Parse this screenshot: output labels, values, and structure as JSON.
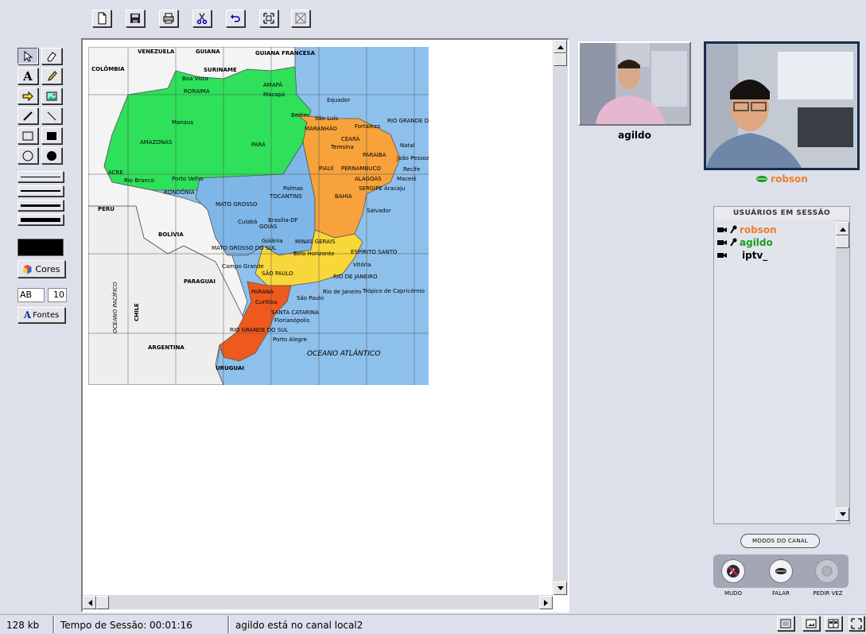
{
  "toolbar": {
    "icons": [
      "new-document-icon",
      "save-icon",
      "print-icon",
      "cut-icon",
      "undo-icon",
      "fit-screen-icon",
      "fullscreen-icon"
    ]
  },
  "tools": {
    "color_label": "Cores",
    "font_sample": "AB",
    "font_size": "10",
    "fonts_label": "Fontes"
  },
  "map": {
    "countries": [
      "VENEZUELA",
      "GUIANA",
      "GUIANA FRANCESA",
      "COLÔMBIA",
      "SURINAME",
      "PERU",
      "BOLÍVIA",
      "PARAGUAI",
      "CHILE",
      "ARGENTINA",
      "URUGUAI"
    ],
    "states": [
      "AMAZONAS",
      "PARÁ",
      "RORAIMA",
      "AMAPÁ",
      "ACRE",
      "RONDÔNIA",
      "MATO GROSSO",
      "TOCANTINS",
      "MARANHÃO",
      "PIAUÍ",
      "CEARÁ",
      "BAHIA",
      "GOIÁS",
      "MINAS GERAIS",
      "ESPÍRITO SANTO",
      "SÃO PAULO",
      "RIO DE JANEIRO",
      "PARANÁ",
      "SANTA CATARINA",
      "RIO GRANDE DO SUL",
      "MATO GROSSO DO SUL",
      "PERNAMBUCO",
      "PARAÍBA",
      "ALAGOAS",
      "SERGIPE",
      "RIO GRANDE DO NORTE"
    ],
    "cities": [
      "Manaus",
      "Belém",
      "São Luís",
      "Fortaleza",
      "Teresina",
      "Natal",
      "João Pessoa",
      "Recife",
      "Maceió",
      "Aracaju",
      "Salvador",
      "Palmas",
      "Cuiabá",
      "Brasília-DF",
      "Goiânia",
      "Campo Grande",
      "Belo Horizonte",
      "Vitória",
      "Rio de Janeiro",
      "São Paulo",
      "Curitiba",
      "Florianópolis",
      "Porto Alegre",
      "Porto Velho",
      "Rio Branco",
      "Boa Vista",
      "Macapá"
    ],
    "ocean_atlantic": "OCEANO ATLÂNTICO",
    "ocean_pacific": "OCEANO PACÍFICO",
    "equator": "Equador",
    "tropic": "Trópico de Capricórnio"
  },
  "videos": [
    {
      "name": "agildo",
      "color": "#1a9e1a"
    },
    {
      "name": "robson",
      "color": "#f07d2a"
    }
  ],
  "users_panel": {
    "title": "USUÁRIOS EM SESSÃO",
    "users": [
      {
        "name": "robson",
        "color": "#f07d2a"
      },
      {
        "name": "agildo",
        "color": "#1a9e1a"
      },
      {
        "name": "iptv_",
        "color": "#000000"
      }
    ]
  },
  "channel": {
    "modes_button": "MODOS DO CANAL",
    "controls": [
      {
        "label": "MUDO",
        "icon": "mute-mic-icon"
      },
      {
        "label": "FALAR",
        "icon": "lips-icon"
      },
      {
        "label": "PEDIR VEZ",
        "icon": "raise-turn-icon"
      }
    ]
  },
  "status": {
    "size": "128 kb",
    "session_time": "Tempo de Sessão: 00:01:16",
    "message": "agildo está no canal local2"
  },
  "colors": {
    "green_states": "#2ee05a",
    "blue_states": "#7fb6e8",
    "orange_states": "#f7a23a",
    "yellow_states": "#f8d73a",
    "red_states": "#ee5a1e",
    "ocean": "#8ec0ec"
  }
}
